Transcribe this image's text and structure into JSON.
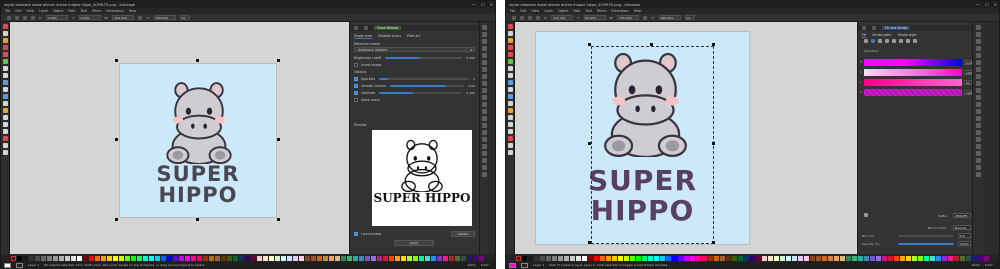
{
  "app": {
    "title": "skylar eleanore made ahmen anime magne hippo_4CMR-TS.png - Inkscape",
    "window_controls": [
      "—",
      "☐",
      "✕"
    ],
    "menus": [
      "File",
      "Edit",
      "View",
      "Layer",
      "Object",
      "Path",
      "Text",
      "Filters",
      "Extensions",
      "Help"
    ]
  },
  "window1": {
    "tool_controls": {
      "x_label": "X:",
      "x_value": "0.000",
      "y_label": "Y:",
      "y_value": "0.000",
      "w_label": "W:",
      "w_value": "700.000",
      "h_label": "H:",
      "h_value": "700.000",
      "unit": "px"
    },
    "panel": {
      "tabs": [
        "Trace Bitmap"
      ],
      "subtabs": [
        "Single scan",
        "Multiple scans",
        "Pixel art"
      ],
      "detection_mode_label": "Detection mode:",
      "detection_mode_value": "Autotrace (slower)",
      "threshold_label": "Brightness cutoff",
      "threshold_value": "0.450",
      "invert_label": "Invert image",
      "options_label": "Options",
      "options": [
        {
          "label": "Speckles",
          "value": "2",
          "checked": true,
          "level": 0.1
        },
        {
          "label": "Smooth corners",
          "value": "1.00",
          "checked": true,
          "level": 0.75
        },
        {
          "label": "Optimize",
          "value": "0.200",
          "checked": true,
          "level": 0.4
        },
        {
          "label": "Stack scans",
          "value": "",
          "checked": false,
          "level": 0
        }
      ],
      "preview_label": "Preview",
      "preview_title": "SUPER HIPPO",
      "live_preview_label": "Live preview",
      "update_label": "Update",
      "apply_label": "Apply"
    },
    "status": {
      "layer": "Layer 1",
      "message": "No objects selected. Click, Shift+click, Alt+scroll mouse on top of objects, or drag around objects to select.",
      "zoom": "100%",
      "rotation": "0.00°"
    }
  },
  "window2": {
    "tool_controls": {
      "x_label": "X:",
      "x_value": "110.165",
      "y_label": "Y:",
      "y_value": "84.457",
      "w_label": "W:",
      "w_value": "375.065",
      "h_label": "H:",
      "h_value": "566.661",
      "unit": "px"
    },
    "panel": {
      "tabs": [
        "Fill and Stroke"
      ],
      "subtabs": [
        "Fill",
        "Stroke paint",
        "Stroke style"
      ],
      "channels_label": "Specified",
      "channels": [
        {
          "label": "H",
          "value": "234"
        },
        {
          "label": "S",
          "value": "100"
        },
        {
          "label": "L",
          "value": "50"
        },
        {
          "label": "A",
          "value": "100"
        }
      ],
      "hex_label": "RGBA:",
      "hex_value": "4f004fff",
      "blend_label": "Blend mode",
      "blend_value": "Normal",
      "blur_label": "Blur (%)",
      "blur_value": "0.0",
      "opacity_label": "Opacity (%)",
      "opacity_value": "100.0"
    },
    "status": {
      "layer": "Layer 1",
      "message": "Path 77 nodes in layer Layer 1. Click selection to toggle scale/rotation handles.",
      "zoom": "102%",
      "rotation": "0.00°"
    }
  },
  "artwork": {
    "line1": "SUPER",
    "line2": "HIPPO"
  },
  "colors": {
    "page_bg": "#cce9fa",
    "hippo_body": "#cfcdd2",
    "hippo_outline": "#3a3340",
    "cheek": "#f4c3c8",
    "text_purple_light": "#4a4750",
    "text_purple_dark": "#574060",
    "accent": "#3a79c4"
  },
  "palette": [
    "#000000",
    "#1a1a1a",
    "#333333",
    "#4d4d4d",
    "#666666",
    "#808080",
    "#999999",
    "#b3b3b3",
    "#cccccc",
    "#e6e6e6",
    "#ffffff",
    "#800000",
    "#ff0000",
    "#ff6600",
    "#ff9900",
    "#ffcc00",
    "#ffff00",
    "#ccff00",
    "#66ff00",
    "#00ff00",
    "#00ff66",
    "#00ffcc",
    "#00ffff",
    "#00ccff",
    "#0066ff",
    "#0000ff",
    "#6600ff",
    "#cc00ff",
    "#ff00ff",
    "#ff0099",
    "#ff0066",
    "#993300",
    "#cc6600",
    "#996633",
    "#663300",
    "#336600",
    "#006633",
    "#003366",
    "#330066",
    "#660033",
    "#ffcccc",
    "#ffe5cc",
    "#ffffcc",
    "#ccffcc",
    "#ccffff",
    "#cce5ff",
    "#e5ccff",
    "#ffcce5",
    "#8b4513",
    "#a0522d",
    "#d2691e",
    "#cd853f",
    "#f4a460",
    "#deb887",
    "#2e8b57",
    "#3cb371",
    "#20b2aa",
    "#4682b4",
    "#6a5acd",
    "#9370db",
    "#c71585",
    "#dc143c",
    "#ff4500",
    "#ffa500",
    "#ffd700",
    "#adff2f",
    "#7fff00",
    "#00fa9a",
    "#40e0d0",
    "#1e90ff",
    "#8a2be2",
    "#ff1493",
    "#b22222",
    "#556b2f",
    "#2f4f4f",
    "#191970",
    "#4b0082",
    "#800080"
  ]
}
